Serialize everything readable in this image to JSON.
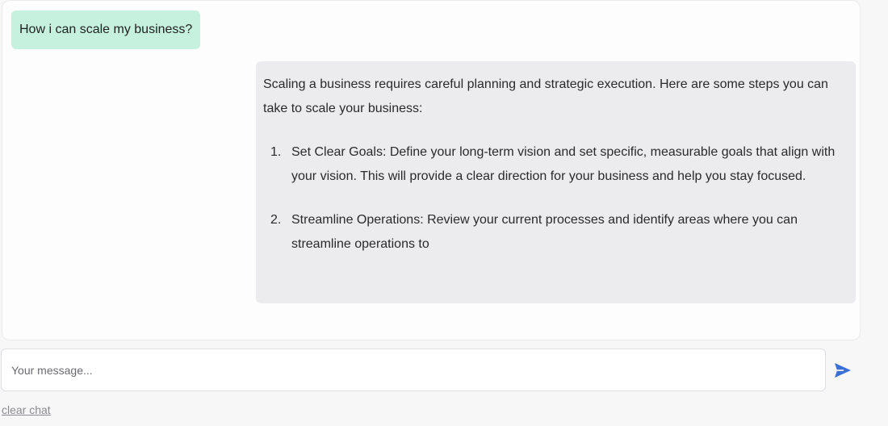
{
  "conversation": {
    "user_message": "How i can scale my business?",
    "assistant": {
      "intro": "Scaling a business requires careful planning and strategic execution. Here are some steps you can take to scale your business:",
      "steps": [
        {
          "number": "1.",
          "text": "Set Clear Goals: Define your long-term vision and set specific, measurable goals that align with your vision. This will provide a clear direction for your business and help you stay focused."
        },
        {
          "number": "2.",
          "text": "Streamline Operations: Review your current processes and identify areas where you can streamline operations to"
        }
      ]
    }
  },
  "composer": {
    "placeholder": "Your message...",
    "send_icon": "send-arrow-icon"
  },
  "footer": {
    "clear_label": "clear chat"
  },
  "colors": {
    "user_bubble": "#c6f1df",
    "assistant_bubble": "#ececee",
    "accent": "#3b6fd8"
  }
}
